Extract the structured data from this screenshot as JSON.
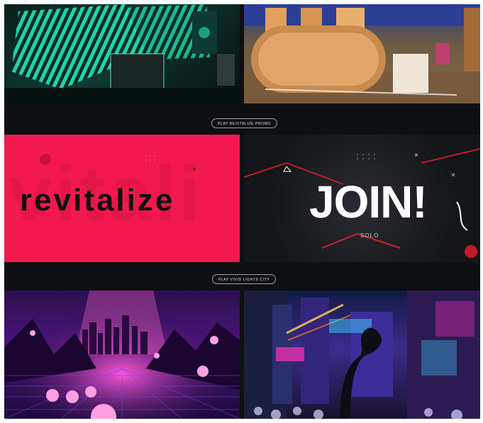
{
  "buttons": {
    "promo1": "PLAY REVITALIZE PROMO",
    "promo2": "PLAY VIVID LIGHTS CITY"
  },
  "tiles": {
    "revitalize_text": "revitalize",
    "revitalize_bg_text": "vitali",
    "join_text": "JOIN!",
    "join_sub": "SOLO"
  },
  "colors": {
    "revitalize_bg": "#f3194f",
    "teal": "#1fe6b6",
    "neon_pink": "#ff2fb6",
    "neon_blue": "#3bd1ff"
  }
}
